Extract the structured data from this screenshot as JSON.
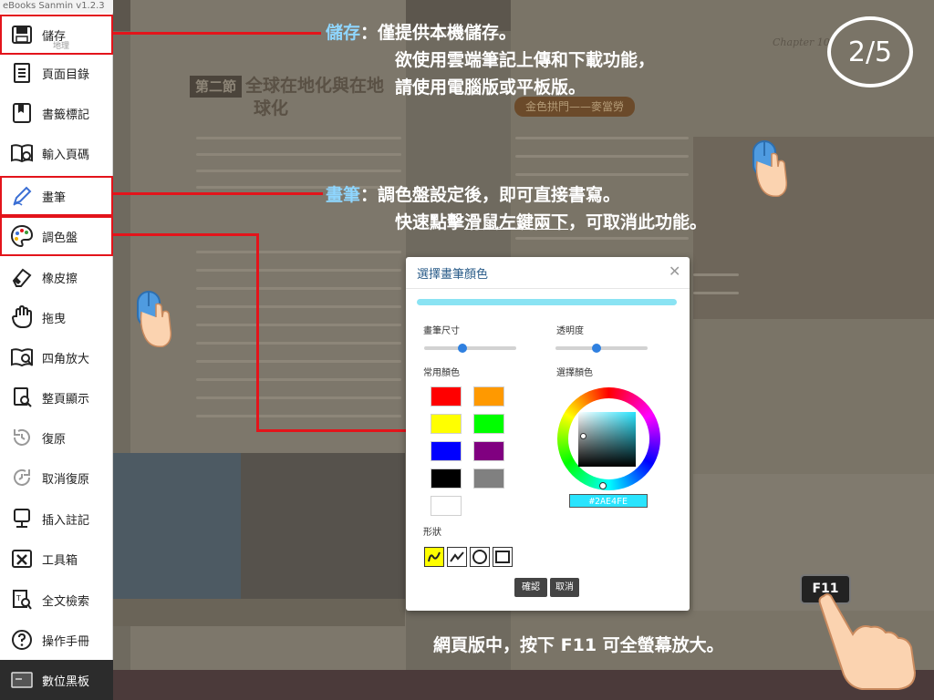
{
  "app": {
    "title": "eBooks Sanmin v1.2.3"
  },
  "sidebar": {
    "sub_label": "地理",
    "items": [
      {
        "label": "儲存",
        "icon": "save-icon"
      },
      {
        "label": "頁面目錄",
        "icon": "page-list-icon"
      },
      {
        "label": "書籤標記",
        "icon": "bookmark-icon"
      },
      {
        "label": "輸入頁碼",
        "icon": "page-number-icon"
      },
      {
        "label": "畫筆",
        "icon": "pen-icon"
      },
      {
        "label": "調色盤",
        "icon": "palette-icon"
      },
      {
        "label": "橡皮擦",
        "icon": "eraser-icon"
      },
      {
        "label": "拖曳",
        "icon": "drag-hand-icon"
      },
      {
        "label": "四角放大",
        "icon": "corner-zoom-icon"
      },
      {
        "label": "整頁顯示",
        "icon": "fit-page-icon"
      },
      {
        "label": "復原",
        "icon": "undo-icon"
      },
      {
        "label": "取消復原",
        "icon": "redo-icon"
      },
      {
        "label": "插入註記",
        "icon": "insert-note-icon"
      },
      {
        "label": "工具箱",
        "icon": "toolbox-icon"
      },
      {
        "label": "全文檢索",
        "icon": "full-text-search-icon"
      },
      {
        "label": "操作手冊",
        "icon": "help-icon"
      },
      {
        "label": "數位黑板",
        "icon": "digital-blackboard-icon"
      }
    ]
  },
  "book": {
    "section_tag": "第二節",
    "section_title_1": "全球在地化與在地",
    "section_title_2": "球化",
    "right_banner": "金色拱門——麥當勞",
    "chapter_label": "Chapter 10"
  },
  "annotations": {
    "save": {
      "key": "儲存",
      "line1": "：僅提供本機儲存。",
      "line2": "欲使用雲端筆記上傳和下載功能，",
      "line3": "請使用電腦版或平板版。"
    },
    "pen": {
      "key": "畫筆",
      "line1": "：調色盤設定後，即可直接書寫。",
      "line2_a": "快速點擊",
      "line2_ul": "滑鼠左鍵兩下",
      "line2_b": "，可取消此功能。"
    },
    "f11": "網頁版中，按下 F11 可全螢幕放大。"
  },
  "badge": "2/5",
  "f11_key": "F11",
  "dialog": {
    "title": "選擇畫筆顏色",
    "pen_size_label": "畫筆尺寸",
    "opacity_label": "透明度",
    "common_colors_label": "常用顏色",
    "select_color_label": "選擇顏色",
    "shape_label": "形狀",
    "hex_value": "#2AE4FE",
    "confirm_label": "確認",
    "cancel_label": "取消",
    "swatches": [
      "#ff0000",
      "#ff9900",
      "#ffff00",
      "#00ff00",
      "#0000ff",
      "#800080",
      "#000000",
      "#808080",
      "#ffffff"
    ],
    "pen_size_level": 0.42,
    "opacity_level": 0.45
  },
  "colors": {
    "highlight": "#e3141b",
    "accent_text": "#8fd6ff",
    "preview": "#8ae3f3"
  }
}
